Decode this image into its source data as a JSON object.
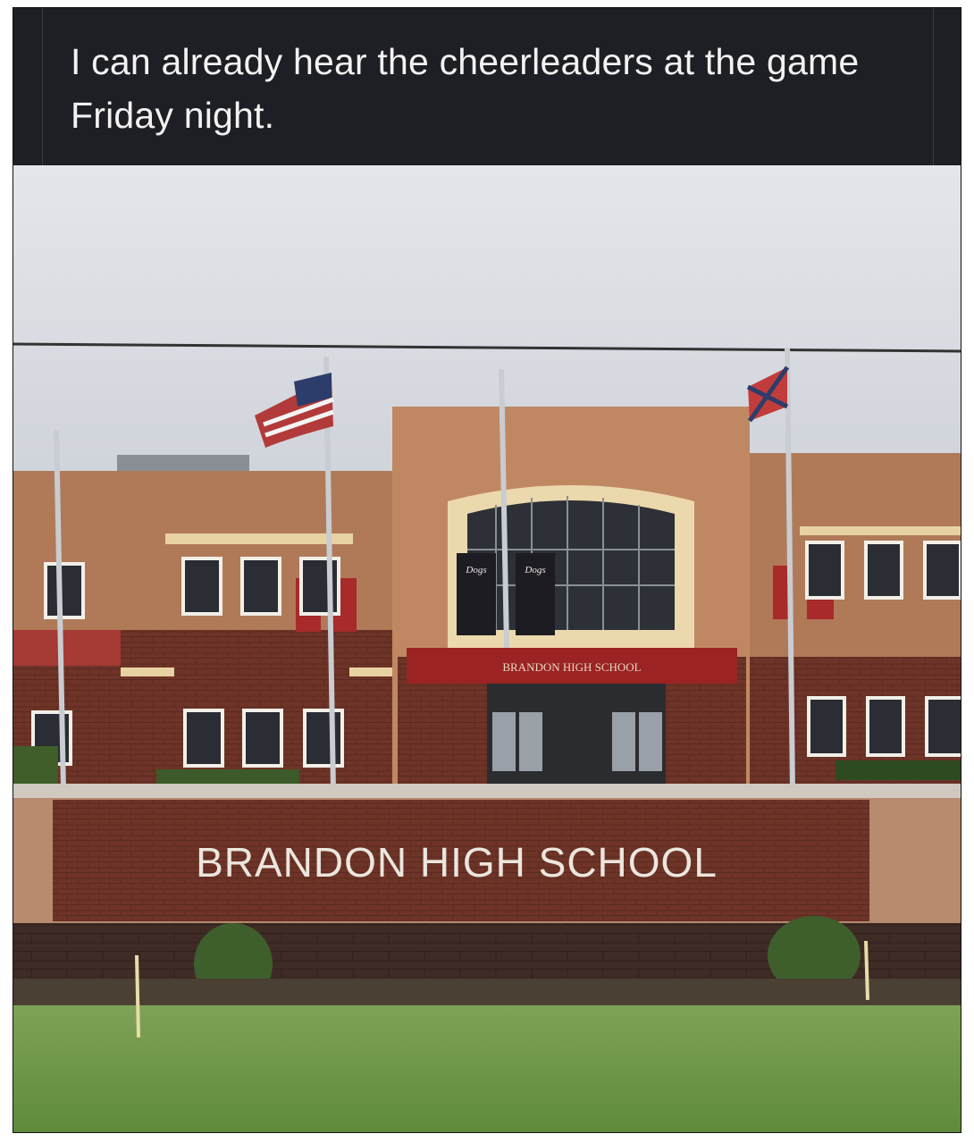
{
  "post": {
    "caption": "I can already hear the cheerleaders at the game Friday night."
  },
  "photo": {
    "description_icon": "school-building-photo",
    "sign_text": "BRANDON HIGH SCHOOL",
    "canopy_text": "BRANDON HIGH SCHOOL",
    "banner_text": "Dogs"
  },
  "colors": {
    "caption_bg": "#1e1f24",
    "caption_text": "#f2f2f2",
    "brick": "#7a3e2e",
    "sky": "#d9dce2",
    "grass": "#6f9a4a"
  }
}
